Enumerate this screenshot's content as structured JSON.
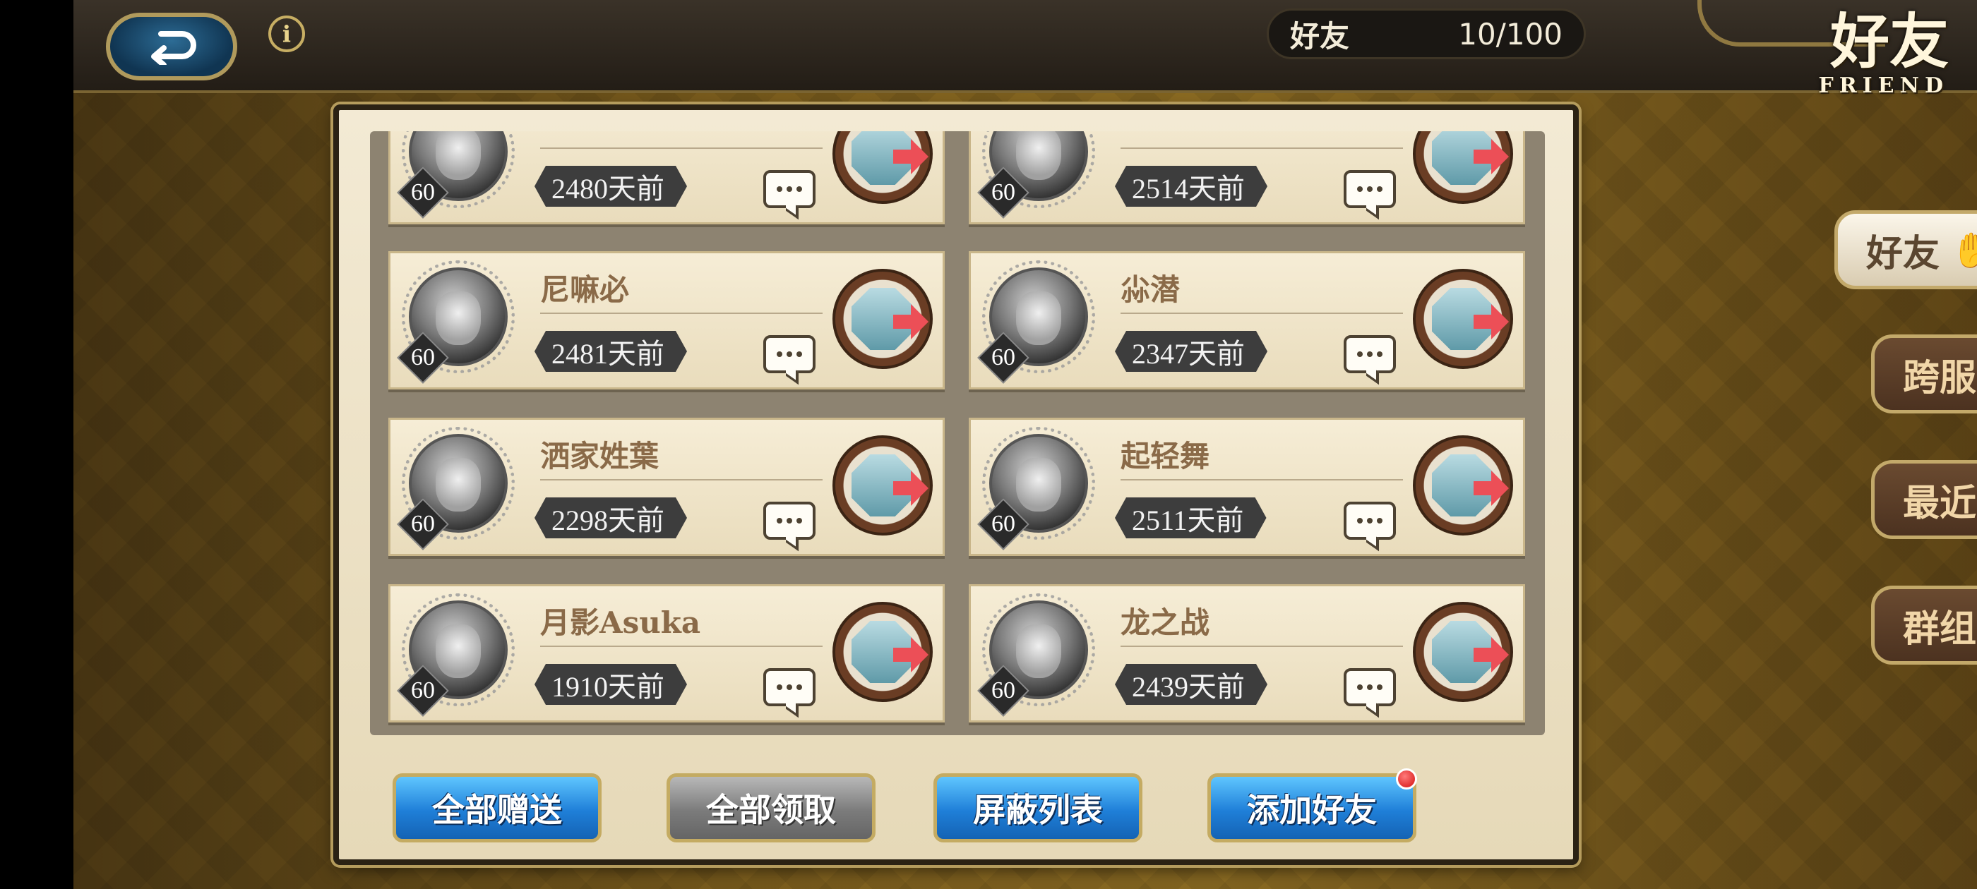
{
  "header": {
    "friend_count_label": "好友",
    "friend_count_value": "10/100",
    "page_title_cn": "好友",
    "page_title_en": "FRIEND"
  },
  "friends": [
    {
      "name": "",
      "level": "60",
      "last_login": "2480天前"
    },
    {
      "name": "",
      "level": "60",
      "last_login": "2514天前"
    },
    {
      "name": "尼嘛必",
      "level": "60",
      "last_login": "2481天前"
    },
    {
      "name": "尛潜",
      "level": "60",
      "last_login": "2347天前"
    },
    {
      "name": "洒家姓葉",
      "level": "60",
      "last_login": "2298天前"
    },
    {
      "name": "起轻舞",
      "level": "60",
      "last_login": "2511天前"
    },
    {
      "name": "月影Asuka",
      "level": "60",
      "last_login": "1910天前"
    },
    {
      "name": "龙之战",
      "level": "60",
      "last_login": "2439天前"
    }
  ],
  "actions": {
    "send_all": "全部赠送",
    "claim_all": "全部领取",
    "block_list": "屏蔽列表",
    "add_friend": "添加好友"
  },
  "tabs": [
    {
      "label": "好友",
      "icon": "handshake-icon"
    },
    {
      "label": "跨服",
      "icon": "server-icon"
    },
    {
      "label": "最近",
      "icon": "recent-icon"
    },
    {
      "label": "群组",
      "icon": "group-icon"
    }
  ],
  "colors": {
    "accent_blue": "#1f7fd8",
    "gift_arrow": "#ec4f57",
    "gold_border": "#c4ab62"
  }
}
